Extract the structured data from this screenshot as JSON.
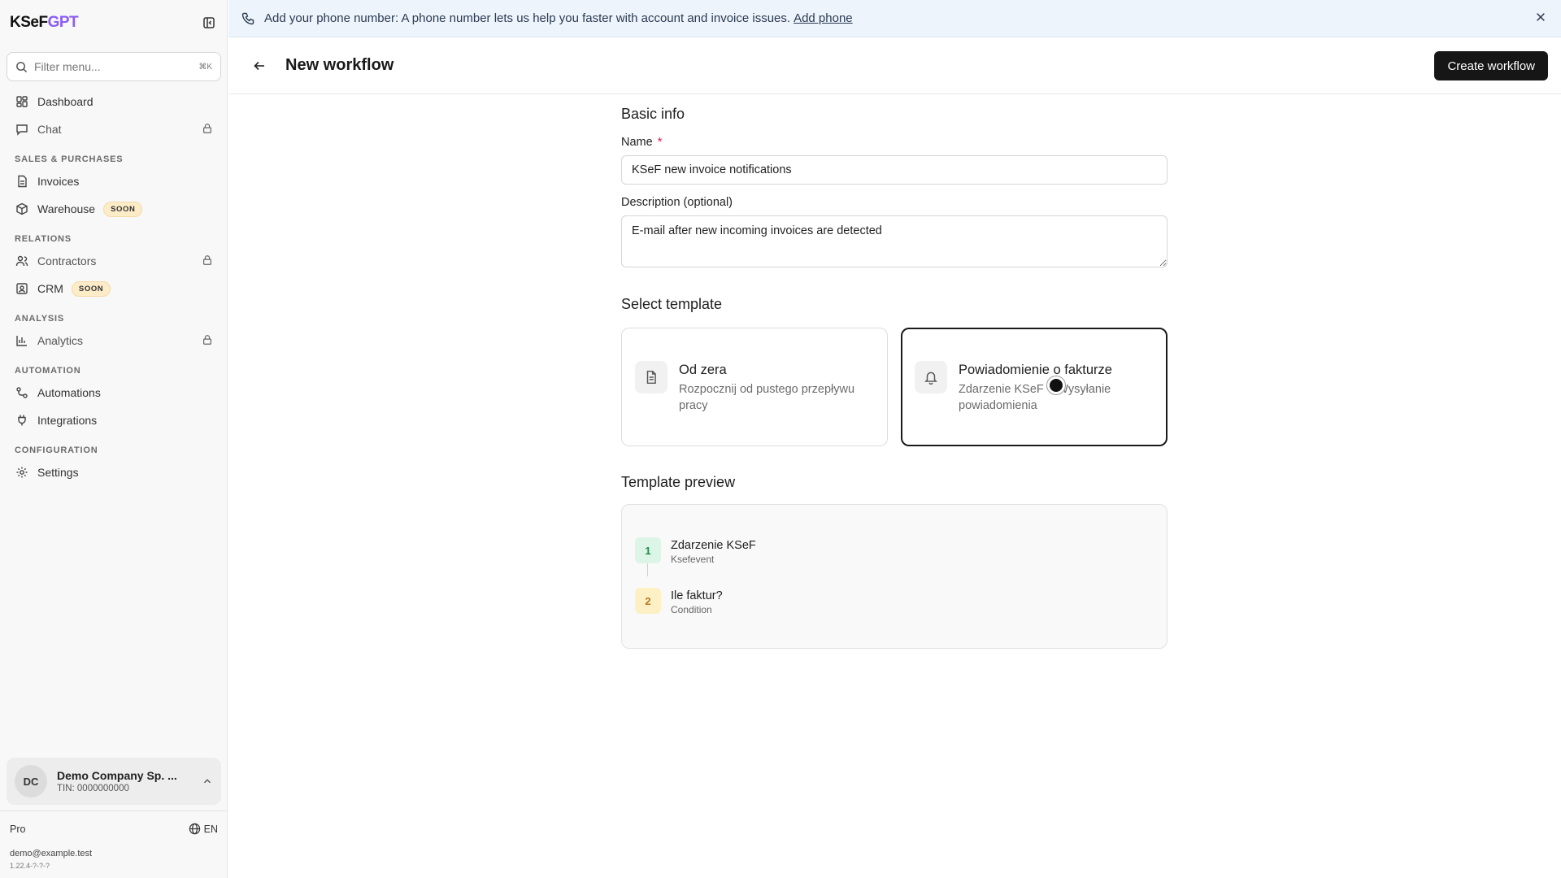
{
  "sidebar": {
    "logo_main": "KSeF",
    "logo_accent": "GPT",
    "search_placeholder": "Filter menu...",
    "search_shortcut": "⌘K",
    "items_top": [
      {
        "label": "Dashboard",
        "icon": "dashboard-icon"
      },
      {
        "label": "Chat",
        "icon": "chat-icon",
        "locked": true
      }
    ],
    "sections": [
      {
        "title": "SALES & PURCHASES",
        "items": [
          {
            "label": "Invoices",
            "icon": "invoice-icon"
          },
          {
            "label": "Warehouse",
            "icon": "box-icon",
            "badge": "SOON"
          }
        ]
      },
      {
        "title": "RELATIONS",
        "items": [
          {
            "label": "Contractors",
            "icon": "users-icon",
            "locked": true
          },
          {
            "label": "CRM",
            "icon": "contact-icon",
            "badge": "SOON"
          }
        ]
      },
      {
        "title": "ANALYSIS",
        "items": [
          {
            "label": "Analytics",
            "icon": "chart-icon",
            "locked": true
          }
        ]
      },
      {
        "title": "AUTOMATION",
        "items": [
          {
            "label": "Automations",
            "icon": "workflow-icon"
          },
          {
            "label": "Integrations",
            "icon": "plug-icon"
          }
        ]
      },
      {
        "title": "CONFIGURATION",
        "items": [
          {
            "label": "Settings",
            "icon": "gear-icon"
          }
        ]
      }
    ],
    "company": {
      "initials": "DC",
      "name": "Demo Company Sp. ...",
      "tin": "TIN: 0000000000"
    },
    "plan": "Pro",
    "language": "EN",
    "email": "demo@example.test",
    "version": "1.22.4-?-?-?"
  },
  "banner": {
    "text": "Add your phone number: A phone number lets us help you faster with account and invoice issues.",
    "link": "Add phone"
  },
  "header": {
    "title": "New workflow",
    "create_button": "Create workflow"
  },
  "form": {
    "basic_info_title": "Basic info",
    "name_label": "Name",
    "name_required_mark": "*",
    "name_value": "KSeF new invoice notifications",
    "description_label": "Description (optional)",
    "description_value": "E-mail after new incoming invoices are detected",
    "select_template_title": "Select template",
    "templates": [
      {
        "title": "Od zera",
        "description": "Rozpocznij od pustego przepływu pracy",
        "icon": "document-icon",
        "selected": false
      },
      {
        "title": "Powiadomienie o fakturze",
        "description": "Zdarzenie KSeF + Wysyłanie powiadomienia",
        "icon": "bell-icon",
        "selected": true
      }
    ],
    "preview_title": "Template preview",
    "preview_steps": [
      {
        "number": "1",
        "title": "Zdarzenie KSeF",
        "subtitle": "Ksefevent"
      },
      {
        "number": "2",
        "title": "Ile faktur?",
        "subtitle": "Condition"
      }
    ]
  }
}
